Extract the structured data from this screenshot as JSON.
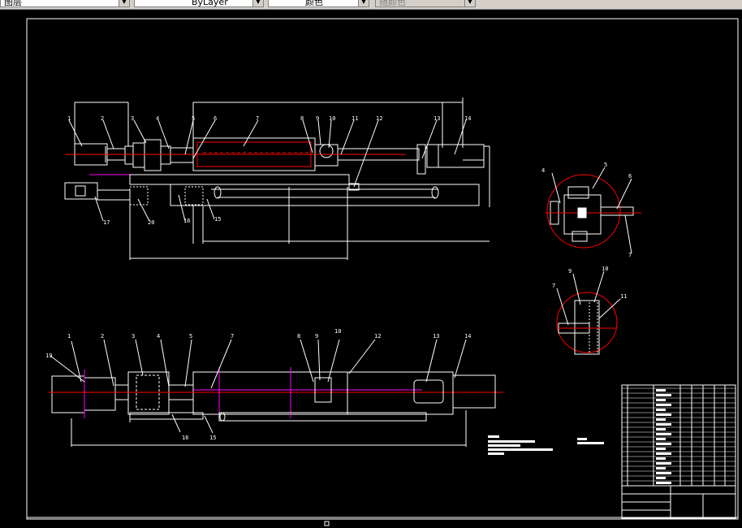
{
  "toolbar": {
    "layer_combo": "图层",
    "linetype_combo": "ByLayer",
    "color_combo": "颜色",
    "plotstyle_combo": "随颜色"
  },
  "drawing": {
    "top_view_labels": [
      "1",
      "2",
      "3",
      "4",
      "5",
      "6",
      "7",
      "8",
      "9",
      "10",
      "11",
      "12",
      "13",
      "14",
      "15",
      "16",
      "17",
      "20"
    ],
    "plan_view_labels": [
      "1",
      "2",
      "3",
      "4",
      "5",
      "7",
      "8",
      "9",
      "10",
      "12",
      "13",
      "14",
      "15",
      "16",
      "19"
    ],
    "detail_a_labels": [
      "4",
      "5",
      "6",
      "7"
    ],
    "detail_b_labels": [
      "7",
      "9",
      "10",
      "11"
    ]
  },
  "colors": {
    "background": "#000000",
    "lines": "#ffffff",
    "accent": "#ff0000",
    "magenta": "#ff00ff",
    "toolbar": "#d4d0c8"
  }
}
